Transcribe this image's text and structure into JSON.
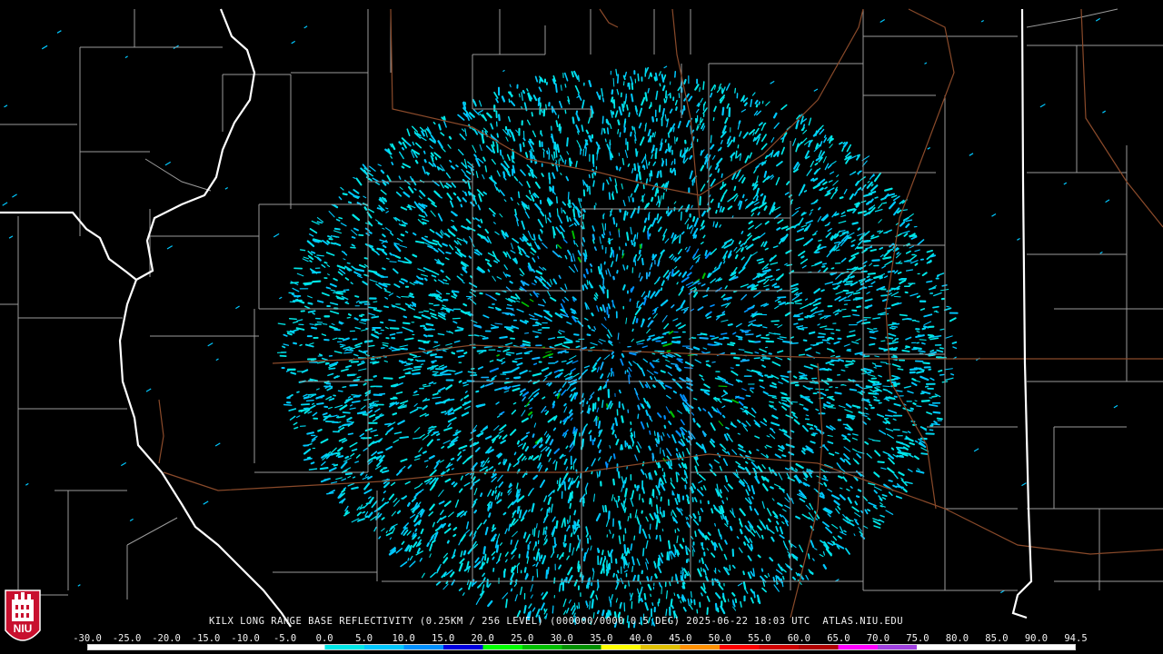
{
  "radar": {
    "station": "KILX",
    "caption": "KILX LONG RANGE BASE REFLECTIVITY (0.25KM / 256 LEVEL) (000000/0000 0.5 DEG) 2025-06-22 18:03 UTC  ATLAS.NIU.EDU"
  },
  "colorbar": {
    "ticks": [
      "-30.0",
      "-25.0",
      "-20.0",
      "-15.0",
      "-10.0",
      "-5.0",
      "0.0",
      "5.0",
      "10.0",
      "15.0",
      "20.0",
      "25.0",
      "30.0",
      "35.0",
      "40.0",
      "45.0",
      "50.0",
      "55.0",
      "60.0",
      "65.0",
      "70.0",
      "75.0",
      "80.0",
      "85.0",
      "90.0",
      "94.5"
    ],
    "colors": [
      "#ffffff",
      "#ffffff",
      "#ffffff",
      "#ffffff",
      "#ffffff",
      "#ffffff",
      "#00e8e8",
      "#00c8ff",
      "#0090ff",
      "#0000e0",
      "#00ff00",
      "#00c000",
      "#009000",
      "#ffff00",
      "#e0c000",
      "#ff9000",
      "#ff0000",
      "#d00000",
      "#b00000",
      "#ff00ff",
      "#a040e0",
      "#ffffff",
      "#ffffff",
      "#ffffff",
      "#ffffff"
    ]
  },
  "logo": {
    "text": "NIU",
    "color": "#c8102e"
  }
}
